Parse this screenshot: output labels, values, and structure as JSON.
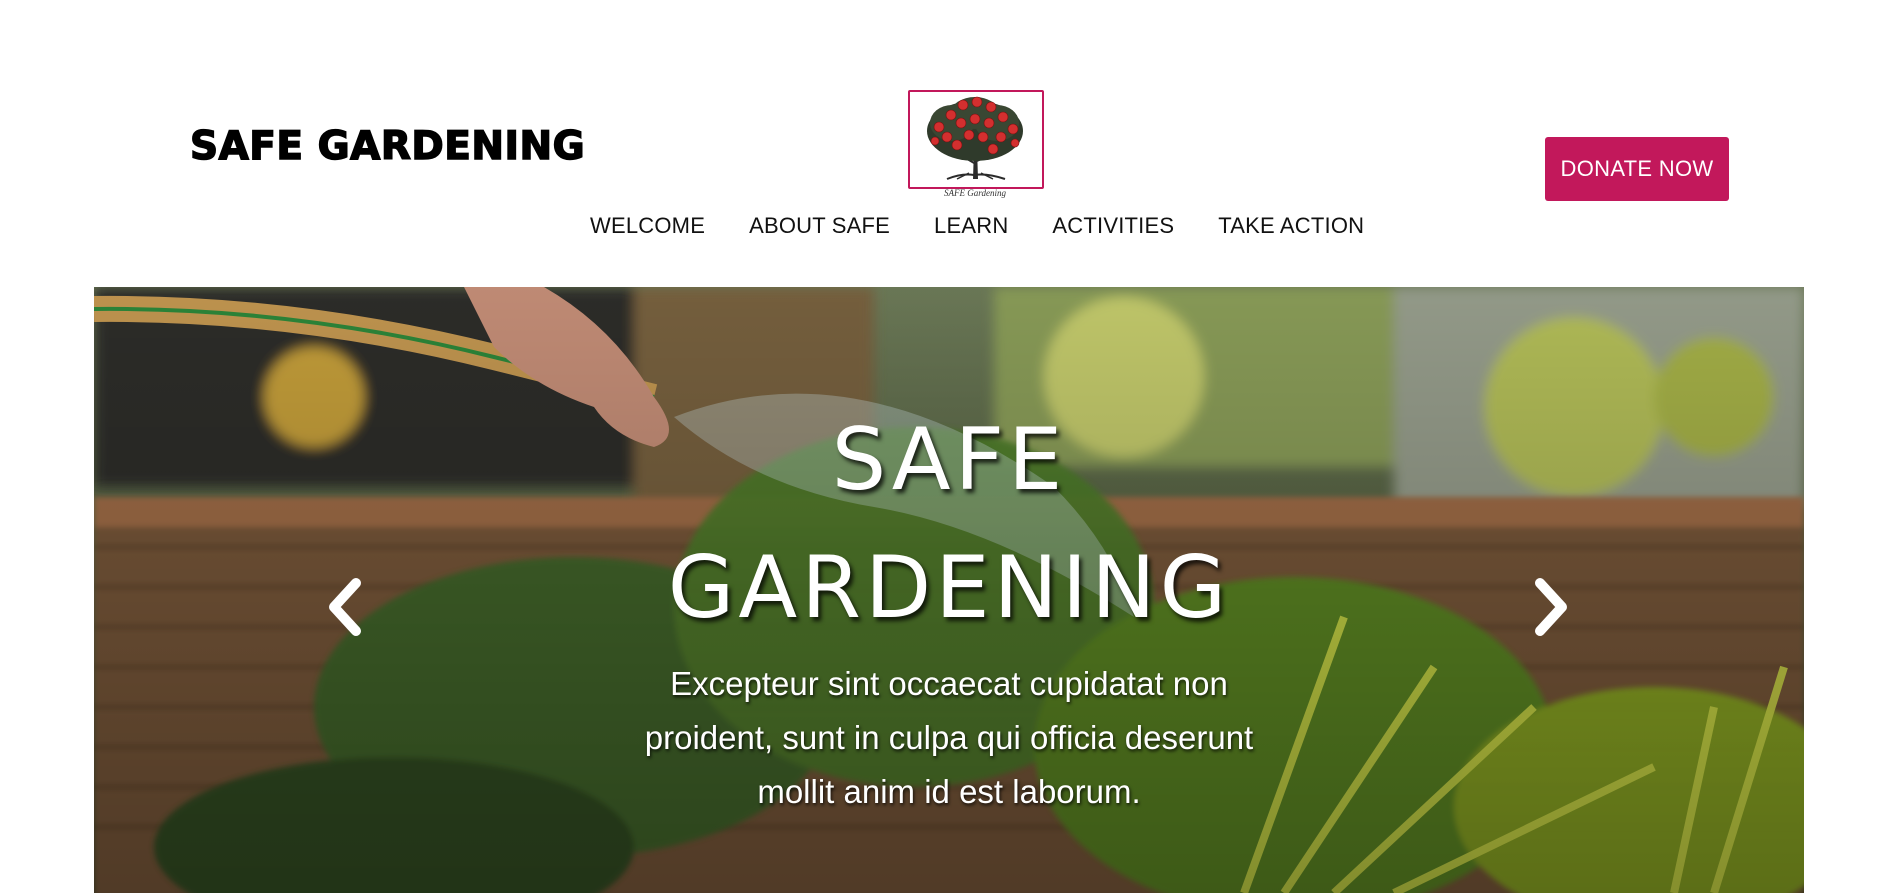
{
  "header": {
    "brand": "SAFE GARDENING",
    "logo_caption": "SAFE Gardening",
    "donate_label": "DONATE NOW"
  },
  "nav": {
    "items": [
      {
        "label": "WELCOME"
      },
      {
        "label": "ABOUT SAFE"
      },
      {
        "label": "LEARN"
      },
      {
        "label": "ACTIVITIES"
      },
      {
        "label": "TAKE ACTION"
      }
    ]
  },
  "hero": {
    "title_line1": "SAFE",
    "title_line2": "GARDENING",
    "text": "Excepteur sint occaecat cupidatat non proident, sunt in culpa qui officia deserunt mollit anim id est laborum.",
    "prev_icon": "chevron-left-icon",
    "next_icon": "chevron-right-icon"
  },
  "colors": {
    "accent": "#c2185b",
    "text": "#111111",
    "background": "#ffffff"
  }
}
